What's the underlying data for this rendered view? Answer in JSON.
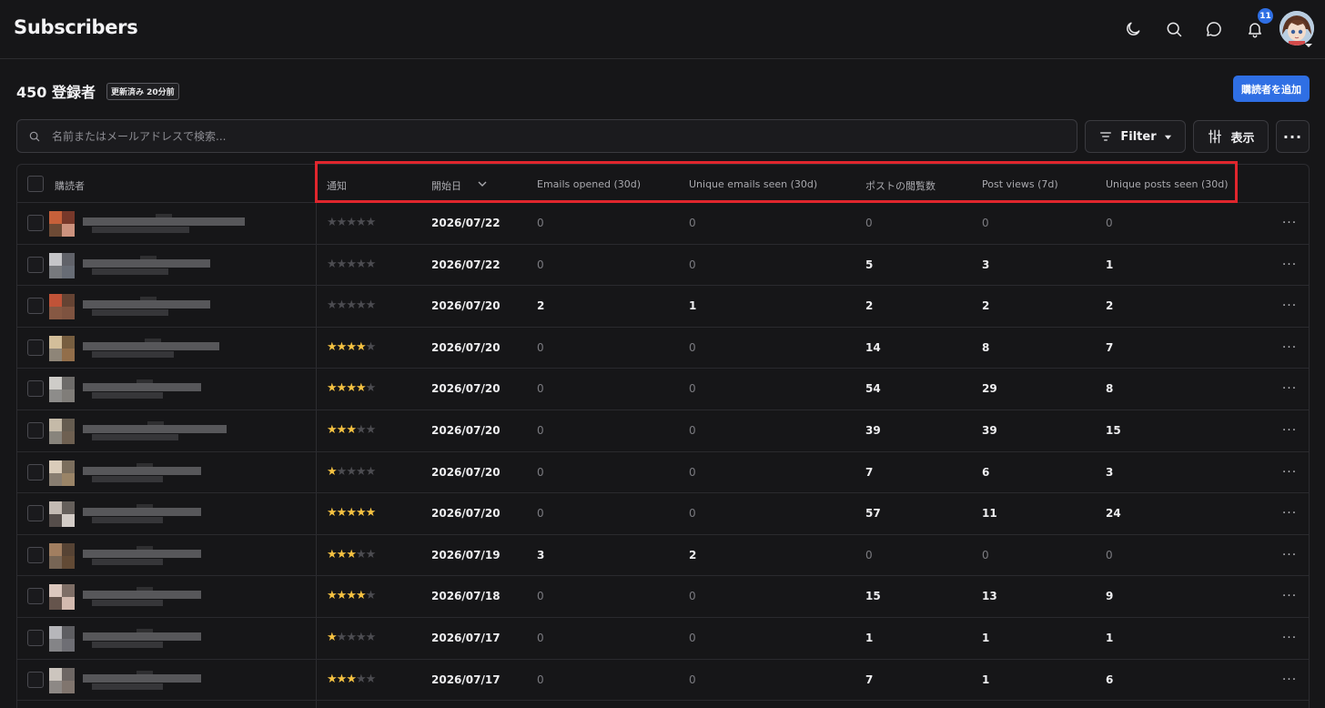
{
  "header": {
    "title": "Subscribers",
    "notification_count": "11",
    "icons": [
      "moon-icon",
      "search-icon",
      "chat-icon",
      "bell-icon"
    ]
  },
  "summary": {
    "count_text": "450 登録者",
    "updated_badge": "更新済み 20分前",
    "add_button": "購読者を追加"
  },
  "toolbar": {
    "search_placeholder": "名前またはメールアドレスで検索...",
    "filter_label": "Filter",
    "display_label": "表示"
  },
  "colors": {
    "accent": "#2f6fe4",
    "highlight": "#e0262d",
    "star": "#f5c242",
    "background": "#161618"
  },
  "table": {
    "columns": {
      "subscriber": "購読者",
      "notify": "通知",
      "start_date": "開始日",
      "emails_opened": "Emails opened (30d)",
      "unique_emails": "Unique emails seen (30d)",
      "post_views_total": "ポストの閲覧数",
      "post_views_7d": "Post views (7d)",
      "unique_posts": "Unique posts seen (30d)"
    },
    "sort_column": "start_date",
    "rows": [
      {
        "stars": 0,
        "date": "2026/07/22",
        "emails_opened": "0",
        "unique_emails": "0",
        "post_views_total": "0",
        "post_views_7d": "0",
        "unique_posts": "0"
      },
      {
        "stars": 0,
        "date": "2026/07/22",
        "emails_opened": "0",
        "unique_emails": "0",
        "post_views_total": "5",
        "post_views_7d": "3",
        "unique_posts": "1"
      },
      {
        "stars": 0,
        "date": "2026/07/20",
        "emails_opened": "2",
        "unique_emails": "1",
        "post_views_total": "2",
        "post_views_7d": "2",
        "unique_posts": "2"
      },
      {
        "stars": 4,
        "date": "2026/07/20",
        "emails_opened": "0",
        "unique_emails": "0",
        "post_views_total": "14",
        "post_views_7d": "8",
        "unique_posts": "7"
      },
      {
        "stars": 4,
        "date": "2026/07/20",
        "emails_opened": "0",
        "unique_emails": "0",
        "post_views_total": "54",
        "post_views_7d": "29",
        "unique_posts": "8"
      },
      {
        "stars": 3,
        "date": "2026/07/20",
        "emails_opened": "0",
        "unique_emails": "0",
        "post_views_total": "39",
        "post_views_7d": "39",
        "unique_posts": "15"
      },
      {
        "stars": 1,
        "date": "2026/07/20",
        "emails_opened": "0",
        "unique_emails": "0",
        "post_views_total": "7",
        "post_views_7d": "6",
        "unique_posts": "3"
      },
      {
        "stars": 5,
        "date": "2026/07/20",
        "emails_opened": "0",
        "unique_emails": "0",
        "post_views_total": "57",
        "post_views_7d": "11",
        "unique_posts": "24"
      },
      {
        "stars": 3,
        "date": "2026/07/19",
        "emails_opened": "3",
        "unique_emails": "2",
        "post_views_total": "0",
        "post_views_7d": "0",
        "unique_posts": "0"
      },
      {
        "stars": 4,
        "date": "2026/07/18",
        "emails_opened": "0",
        "unique_emails": "0",
        "post_views_total": "15",
        "post_views_7d": "13",
        "unique_posts": "9"
      },
      {
        "stars": 1,
        "date": "2026/07/17",
        "emails_opened": "0",
        "unique_emails": "0",
        "post_views_total": "1",
        "post_views_7d": "1",
        "unique_posts": "1"
      },
      {
        "stars": 3,
        "date": "2026/07/17",
        "emails_opened": "0",
        "unique_emails": "0",
        "post_views_total": "7",
        "post_views_7d": "1",
        "unique_posts": "6"
      }
    ]
  }
}
